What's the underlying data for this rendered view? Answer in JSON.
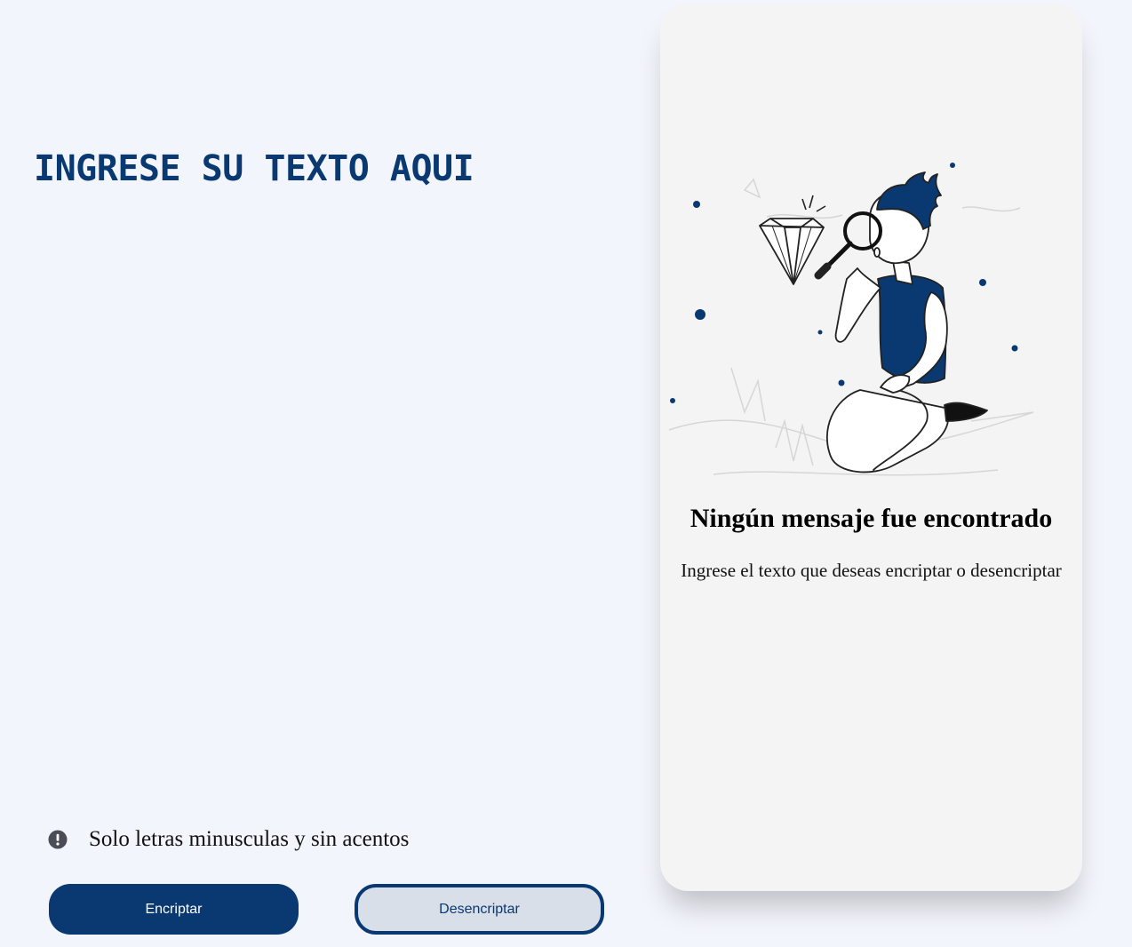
{
  "input": {
    "placeholder": "INGRESE SU TEXTO AQUI",
    "value": ""
  },
  "notice": {
    "icon": "exclamation-circle-icon",
    "text": "Solo letras minusculas y sin acentos"
  },
  "buttons": {
    "encrypt_label": "Encriptar",
    "decrypt_label": "Desencriptar"
  },
  "output": {
    "illustration": "person-with-magnifying-glass-and-diamond",
    "title": "Ningún mensaje fue encontrado",
    "description": "Ingrese el texto que deseas encriptar o desencriptar"
  },
  "colors": {
    "primary": "#0a3871",
    "page_background": "#f3f5fc",
    "card_background": "#f4f4f4",
    "secondary_button_background": "#d8dfe8"
  }
}
